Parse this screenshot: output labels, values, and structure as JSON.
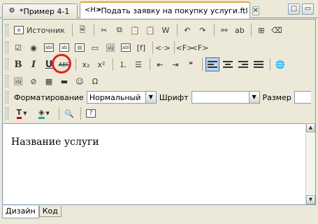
{
  "tabs": [
    {
      "label": "*Пример 4-1",
      "icon": "gear-icon",
      "active": false
    },
    {
      "label": "*Подать заявку на покупку услуги.ftl",
      "icon": "html-file-icon",
      "active": true
    }
  ],
  "window_buttons": {
    "maximize": "□",
    "minimize": "▭"
  },
  "toolbar1": {
    "source_label": "Источник"
  },
  "toolbar5": {
    "format_label": "Форматирование",
    "format_value": "Нормальный",
    "font_label": "Шрифт",
    "font_value": "",
    "size_label": "Размер",
    "size_value": ""
  },
  "content": {
    "text": "Название услуги"
  },
  "bottom_tabs": [
    "Дизайн",
    "Код"
  ],
  "colors": {
    "highlight_circle": "#e02020",
    "active_tab_accent": "#e6a23c"
  }
}
